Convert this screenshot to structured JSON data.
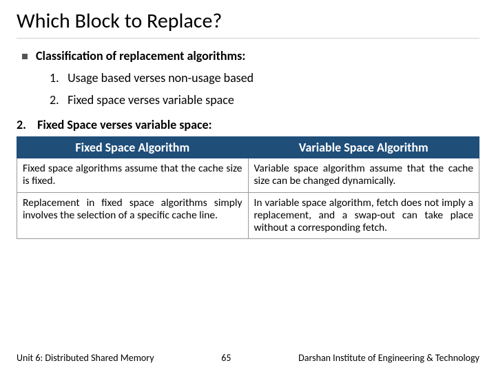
{
  "title": "Which Block to Replace?",
  "bullet": "Classification of replacement algorithms:",
  "items": {
    "n1": "1.",
    "t1": "Usage based verses non-usage based",
    "n2": "2.",
    "t2": "Fixed space verses variable space"
  },
  "section": {
    "num": "2.",
    "text": "Fixed Space verses variable space:"
  },
  "table": {
    "h1": "Fixed Space Algorithm",
    "h2": "Variable Space Algorithm",
    "r1c1": "Fixed space algorithms assume that the cache size is fixed.",
    "r1c2": "Variable space algorithm assume that the cache size can be changed dynamically.",
    "r2c1": "Replacement in fixed space algorithms simply involves the selection of a specific cache line.",
    "r2c2": "In variable space algorithm, fetch does not imply a replacement, and a swap-out can take place without a corresponding fetch."
  },
  "footer": {
    "left": "Unit 6: Distributed Shared Memory",
    "center": "65",
    "right": "Darshan Institute of Engineering & Technology"
  }
}
